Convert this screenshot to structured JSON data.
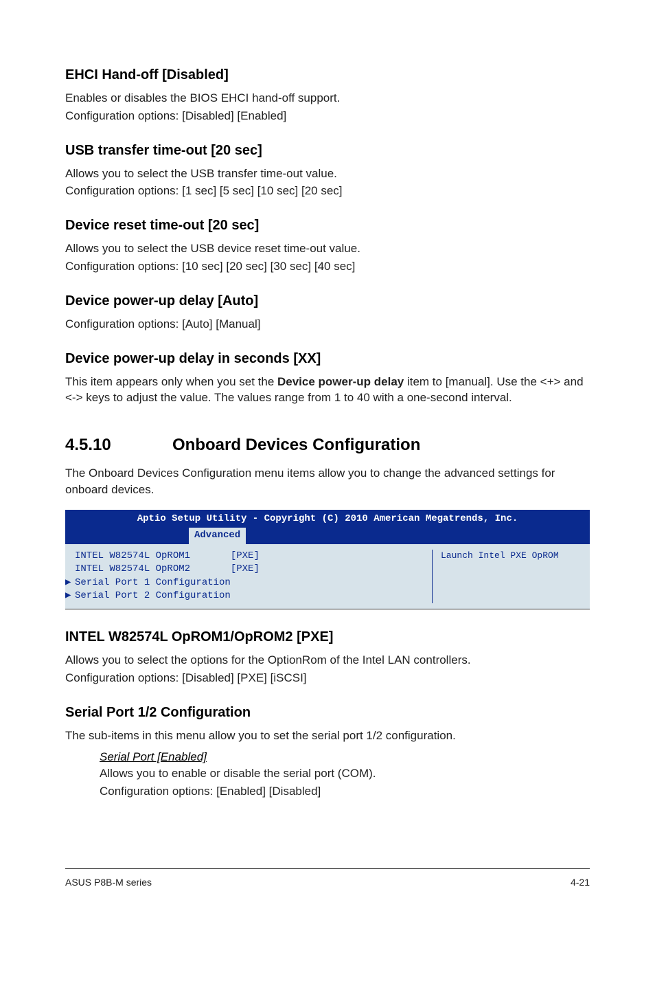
{
  "sec1": {
    "title": "EHCI Hand-off [Disabled]",
    "line1": "Enables or disables the BIOS EHCI hand-off support.",
    "line2": "Configuration options: [Disabled] [Enabled]"
  },
  "sec2": {
    "title": "USB transfer time-out [20 sec]",
    "line1": "Allows you to select the USB transfer time-out value.",
    "line2": "Configuration options: [1 sec] [5 sec] [10 sec] [20 sec]"
  },
  "sec3": {
    "title": "Device reset time-out [20 sec]",
    "line1": "Allows you to select the USB device reset time-out value.",
    "line2": "Configuration options: [10 sec] [20 sec] [30 sec] [40 sec]"
  },
  "sec4": {
    "title": "Device power-up delay [Auto]",
    "line1": "Configuration options: [Auto] [Manual]"
  },
  "sec5": {
    "title": "Device power-up delay in seconds [XX]",
    "pre": "This item appears only when you set the ",
    "bold": "Device power-up delay",
    "post": " item to [manual]. Use the <+> and <-> keys to adjust the value. The values range from 1 to 40 with a one-second interval."
  },
  "mainsec": {
    "num": "4.5.10",
    "title": "Onboard Devices Configuration",
    "desc": "The Onboard Devices Configuration menu items allow you to change the advanced settings for onboard devices."
  },
  "bios": {
    "header": "Aptio Setup Utility - Copyright (C) 2010 American Megatrends, Inc.",
    "tab": "Advanced",
    "rows": [
      {
        "label": "INTEL W82574L OpROM1",
        "value": "[PXE]",
        "arrow": false
      },
      {
        "label": "INTEL W82574L OpROM2",
        "value": "[PXE]",
        "arrow": false
      },
      {
        "label": "Serial Port 1 Configuration",
        "value": "",
        "arrow": true
      },
      {
        "label": "Serial Port 2 Configuration",
        "value": "",
        "arrow": true
      }
    ],
    "help": "Launch Intel PXE OpROM"
  },
  "sec6": {
    "title": "INTEL W82574L OpROM1/OpROM2 [PXE]",
    "line1": "Allows you to select the options for the OptionRom of the Intel LAN controllers.",
    "line2": "Configuration options: [Disabled] [PXE] [iSCSI]"
  },
  "sec7": {
    "title": "Serial Port 1/2 Configuration",
    "line1": "The sub-items in this menu allow you to set the serial port 1/2 configuration.",
    "sub": {
      "title": "Serial Port [Enabled]",
      "line1": "Allows you to enable or disable the serial port (COM).",
      "line2": "Configuration options: [Enabled] [Disabled]"
    }
  },
  "footer": {
    "left": "ASUS P8B-M series",
    "right": "4-21"
  }
}
